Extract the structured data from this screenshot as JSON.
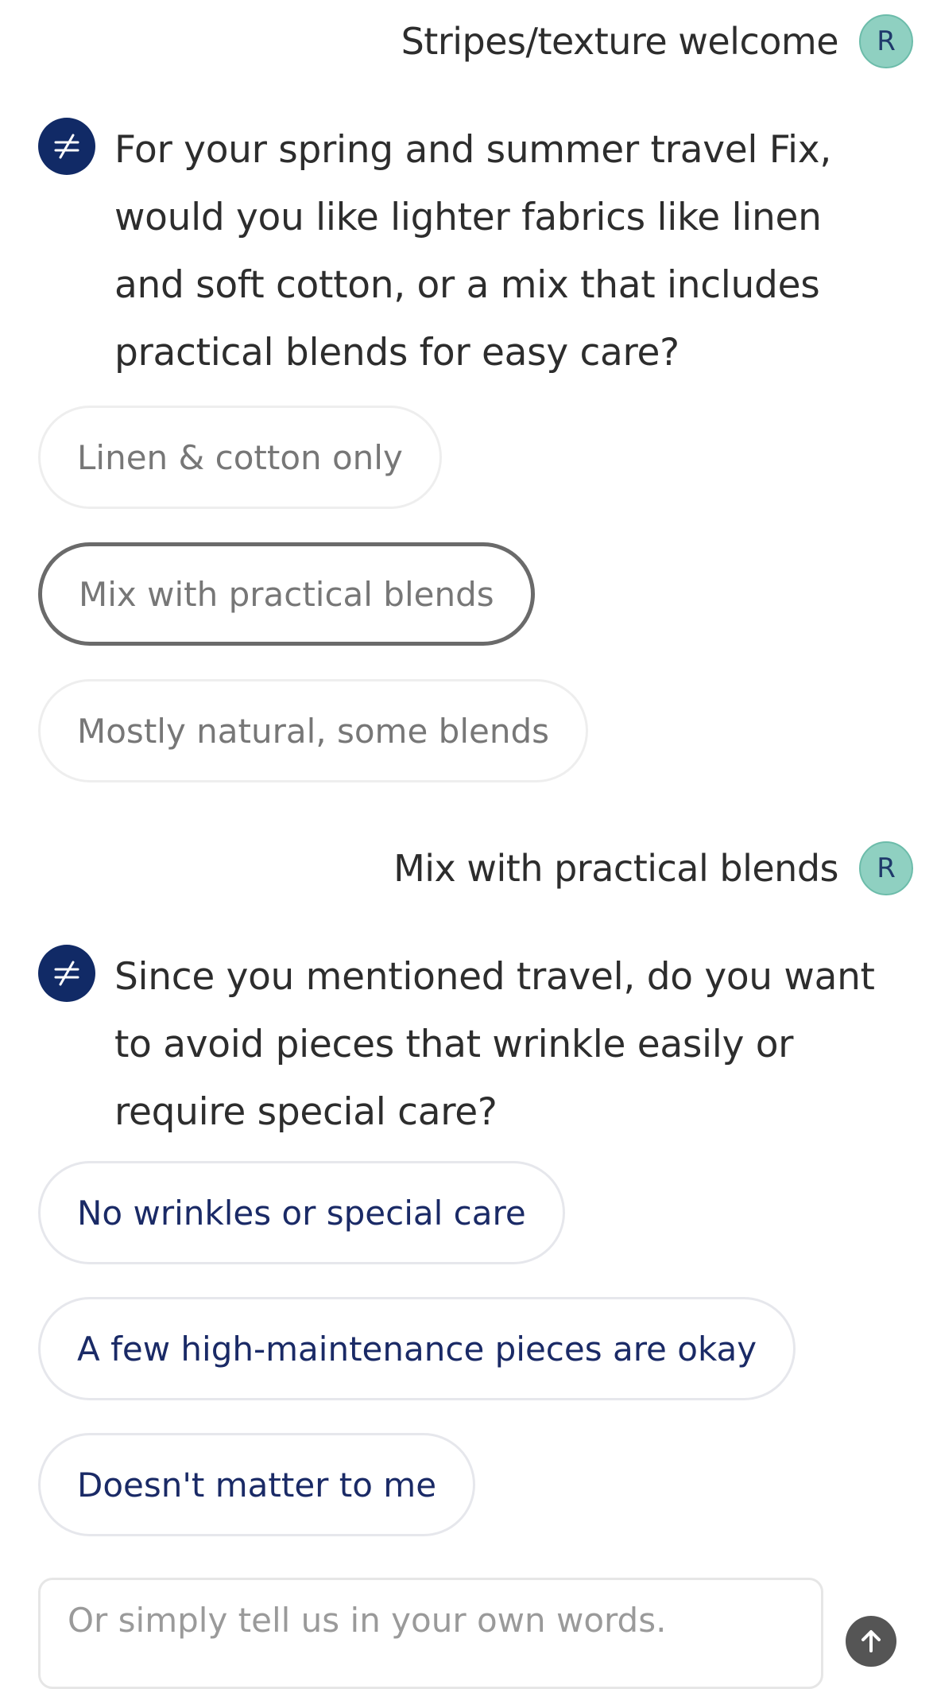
{
  "messages": {
    "user_1": {
      "text": "Stripes/texture welcome",
      "avatar_initial": "R"
    },
    "bot_1": {
      "text": "For your spring and summer travel Fix, would you like lighter fabrics like linen and soft cotton, or a mix that includes practical blends for easy care?"
    },
    "options_1": [
      "Linen & cotton only",
      "Mix with practical blends",
      "Mostly natural, some blends"
    ],
    "user_2": {
      "text": "Mix with practical blends",
      "avatar_initial": "R"
    },
    "bot_2": {
      "text": "Since you mentioned travel, do you want to avoid pieces that wrinkle easily or require special care?"
    },
    "options_2": [
      "No wrinkles or special care",
      "A few high-maintenance pieces are okay",
      "Doesn't matter to me"
    ]
  },
  "composer": {
    "placeholder": "Or simply tell us in your own words."
  },
  "icons": {
    "bot_avatar": "stitch-fix-logo-icon",
    "send": "arrow-up-icon"
  },
  "colors": {
    "bot_avatar_bg": "#112a66",
    "user_avatar_bg": "#8fd0c1",
    "active_option_text": "#1a2a66",
    "send_button_bg": "#555555"
  }
}
